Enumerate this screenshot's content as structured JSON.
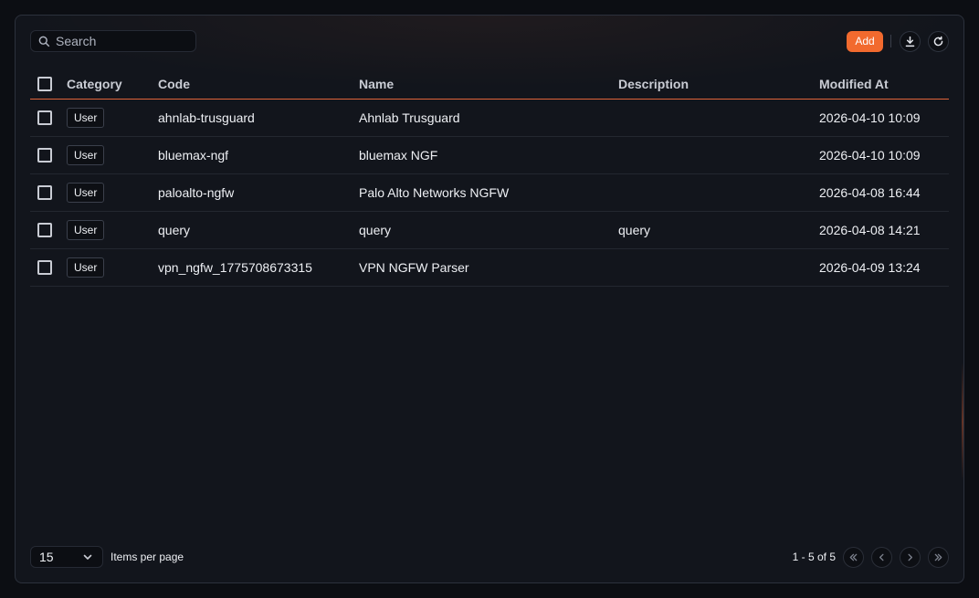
{
  "search": {
    "placeholder": "Search",
    "icon": "search-icon"
  },
  "toolbar": {
    "add_label": "Add",
    "download_icon": "download-icon",
    "refresh_icon": "refresh-icon",
    "accent": "#f26a2e"
  },
  "table": {
    "columns": [
      "Category",
      "Code",
      "Name",
      "Description",
      "Modified At"
    ],
    "rows": [
      {
        "category": "User",
        "code": "ahnlab-trusguard",
        "name": "Ahnlab Trusguard",
        "description": "",
        "modified_at": "2026-04-10 10:09"
      },
      {
        "category": "User",
        "code": "bluemax-ngf",
        "name": "bluemax NGF",
        "description": "",
        "modified_at": "2026-04-10 10:09"
      },
      {
        "category": "User",
        "code": "paloalto-ngfw",
        "name": "Palo Alto Networks NGFW",
        "description": "",
        "modified_at": "2026-04-08 16:44"
      },
      {
        "category": "User",
        "code": "query",
        "name": "query",
        "description": "query",
        "modified_at": "2026-04-08 14:21"
      },
      {
        "category": "User",
        "code": "vpn_ngfw_1775708673315",
        "name": "VPN NGFW Parser",
        "description": "",
        "modified_at": "2026-04-09 13:24"
      }
    ]
  },
  "footer": {
    "per_page_value": "15",
    "per_page_label": "Items per page",
    "range": "1 - 5 of 5"
  }
}
